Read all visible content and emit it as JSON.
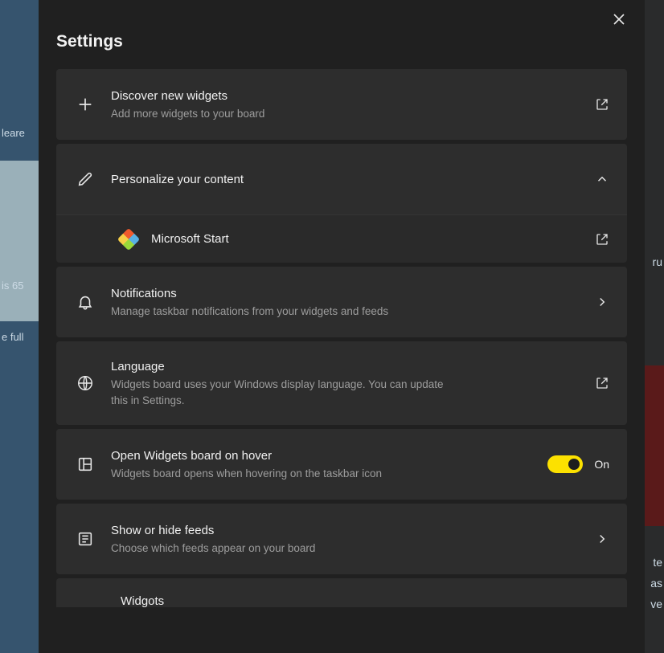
{
  "title": "Settings",
  "bg": {
    "left_1": "leare",
    "left_2": "is 65",
    "left_3": "e full",
    "right_1": "ru",
    "right_2": "te",
    "right_3": "as",
    "right_4": "ve"
  },
  "rows": {
    "discover": {
      "title": "Discover new widgets",
      "sub": "Add more widgets to your board"
    },
    "personalize": {
      "title": "Personalize your content"
    },
    "msstart": {
      "title": "Microsoft Start"
    },
    "notifications": {
      "title": "Notifications",
      "sub": "Manage taskbar notifications from your widgets and feeds"
    },
    "language": {
      "title": "Language",
      "sub": "Widgets board uses your Windows display language. You can update this in Settings."
    },
    "hover": {
      "title": "Open Widgets board on hover",
      "sub": "Widgets board opens when hovering on the taskbar icon",
      "state": "On"
    },
    "feeds": {
      "title": "Show or hide feeds",
      "sub": "Choose which feeds appear on your board"
    },
    "peek": {
      "title": "Widgots"
    }
  }
}
